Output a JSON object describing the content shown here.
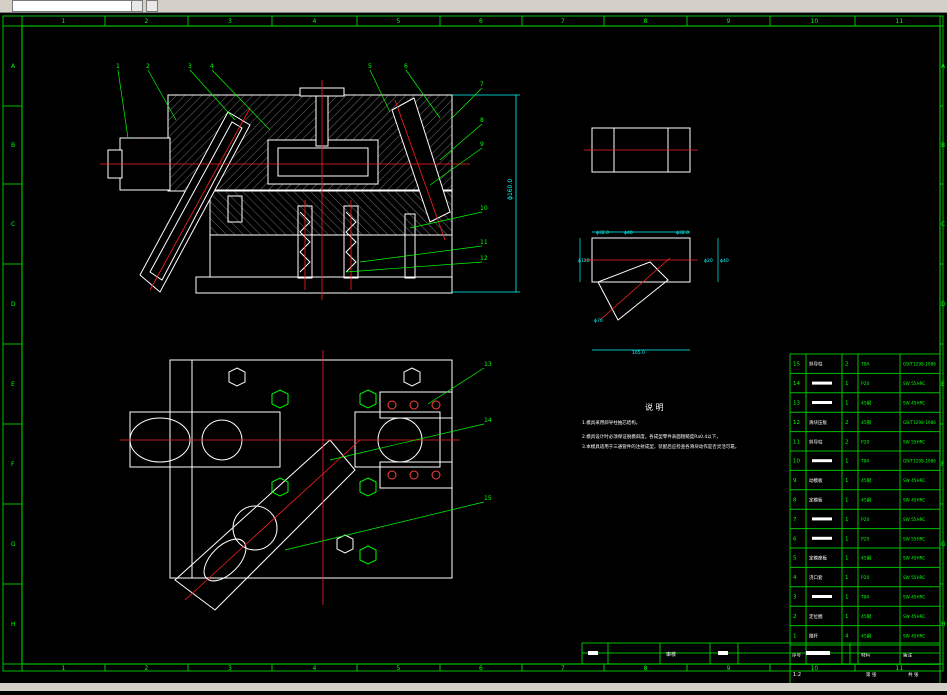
{
  "app": {
    "layer_combo_value": "",
    "layer_icon": "layer-properties-icon",
    "dropdown_icon": "chevron-down-icon"
  },
  "border": {
    "columns": [
      "1",
      "2",
      "3",
      "4",
      "5",
      "6",
      "7",
      "8",
      "9",
      "10",
      "11"
    ],
    "rows": [
      "A",
      "B",
      "C",
      "D",
      "E",
      "F",
      "G",
      "H"
    ]
  },
  "section_view": {
    "leaders": [
      "1",
      "2",
      "3",
      "4",
      "5",
      "6",
      "7",
      "8",
      "9",
      "10",
      "11",
      "12"
    ],
    "height_dim": "ϕ160.0"
  },
  "plan_view": {
    "leaders": [
      "13",
      "14",
      "15"
    ]
  },
  "part_views": {
    "tee_dims": [
      "ϕ32.0",
      "ϕ40",
      "ϕ32.0",
      "ϕ120",
      "ϕ20",
      "ϕ40",
      "ϕ70",
      "165.0"
    ]
  },
  "notes": {
    "title": "说    明",
    "lines": [
      "1.模具采用斜导柱抽芯结构。",
      "2.模具设计时必须保证脱模斜度，各成型零件表面粗糙度Ra0.4以下，",
      "3.本模具适用于三通管件的注射成型，装配后应检查各滑块动作是否灵活可靠。"
    ]
  },
  "bom": {
    "rows": [
      {
        "no": "15",
        "name": "斜导柱",
        "qty": "2",
        "mat": "T8A",
        "std": "GB/T1298-1986"
      },
      {
        "no": "14",
        "name": "",
        "qty": "1",
        "mat": "P20",
        "std": "SW  55HRC"
      },
      {
        "no": "13",
        "name": "",
        "qty": "1",
        "mat": "45钢",
        "std": "SW  45HRC"
      },
      {
        "no": "12",
        "name": "滑块压板",
        "qty": "2",
        "mat": "45钢",
        "std": "GB/T1298-1986"
      },
      {
        "no": "11",
        "name": "斜导柱",
        "qty": "2",
        "mat": "P20",
        "std": "SW  55HRC"
      },
      {
        "no": "10",
        "name": "",
        "qty": "1",
        "mat": "T8A",
        "std": "GB/T1298-1986"
      },
      {
        "no": "9",
        "name": "动模板",
        "qty": "1",
        "mat": "45钢",
        "std": "SW  45HRC"
      },
      {
        "no": "8",
        "name": "定模板",
        "qty": "1",
        "mat": "45钢",
        "std": "SW  45HRC"
      },
      {
        "no": "7",
        "name": "",
        "qty": "1",
        "mat": "P20",
        "std": "SW  55HRC"
      },
      {
        "no": "6",
        "name": "",
        "qty": "1",
        "mat": "P20",
        "std": "SW  55HRC"
      },
      {
        "no": "5",
        "name": "定模座板",
        "qty": "1",
        "mat": "45钢",
        "std": "SW  45HRC"
      },
      {
        "no": "4",
        "name": "浇口套",
        "qty": "1",
        "mat": "P20",
        "std": "SW  55HRC"
      },
      {
        "no": "3",
        "name": "",
        "qty": "1",
        "mat": "T8A",
        "std": "SW  45HRC"
      },
      {
        "no": "2",
        "name": "定位圈",
        "qty": "1",
        "mat": "45钢",
        "std": "SW  45HRC"
      },
      {
        "no": "1",
        "name": "推杆",
        "qty": "4",
        "mat": "45钢",
        "std": "SW  45HRC"
      }
    ],
    "header": {
      "no": "序号",
      "name": "",
      "qty": "",
      "mat": "材料",
      "std": "备注"
    },
    "scale_label": "比例",
    "scale_value": "1:2",
    "sheet_label": "第  张",
    "sheets": "共  张"
  },
  "title_block": {
    "label_a": "制图",
    "label_b": "审核",
    "label_c": "",
    "drawing_no": ""
  },
  "colors": {
    "background": "#000000",
    "outline": "#ffffff",
    "centerline": "#ff2020",
    "dims": "#00ffff",
    "frame": "#00c000",
    "hatch": "#c8c8c8",
    "text_green": "#00ff00",
    "magenta": "#ff00ff",
    "yellow": "#ffff00"
  }
}
